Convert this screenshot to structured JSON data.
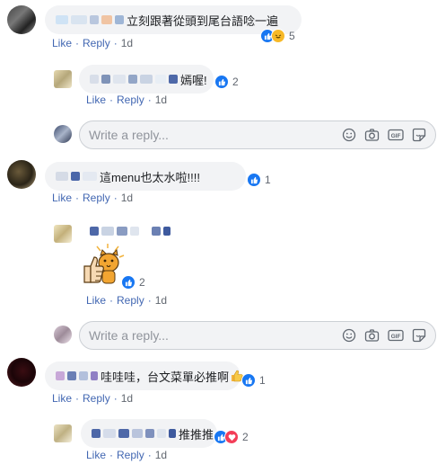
{
  "comments": [
    {
      "text": "立刻跟著從頭到尾台語唸一遍",
      "like": "Like",
      "reply": "Reply",
      "time": "1d",
      "reaction_count": "5"
    },
    {
      "text": "嫣喔!",
      "like": "Like",
      "reply": "Reply",
      "time": "1d",
      "reaction_count": "2"
    },
    {
      "text": "這menu也太水啦!!!!",
      "like": "Like",
      "reply": "Reply",
      "time": "1d",
      "reaction_count": "1"
    },
    {
      "text": "",
      "like": "Like",
      "reply": "Reply",
      "time": "1d",
      "reaction_count": "2"
    },
    {
      "text": "哇哇哇，台文菜單必推啊",
      "like": "Like",
      "reply": "Reply",
      "time": "1d",
      "reaction_count": "1"
    },
    {
      "text": "推推推",
      "like": "Like",
      "reply": "Reply",
      "time": "1d",
      "reaction_count": "2"
    }
  ],
  "separator": "·",
  "reply_placeholder": "Write a reply...",
  "colors": {
    "link": "#4267b2",
    "bubble": "#f2f3f5",
    "like_blue": "#1877f2",
    "heart_red": "#f33e58",
    "haha_yellow": "#f7b928"
  },
  "reply_box_icons": [
    "emoji-icon",
    "camera-icon",
    "gif-icon",
    "sticker-icon"
  ]
}
